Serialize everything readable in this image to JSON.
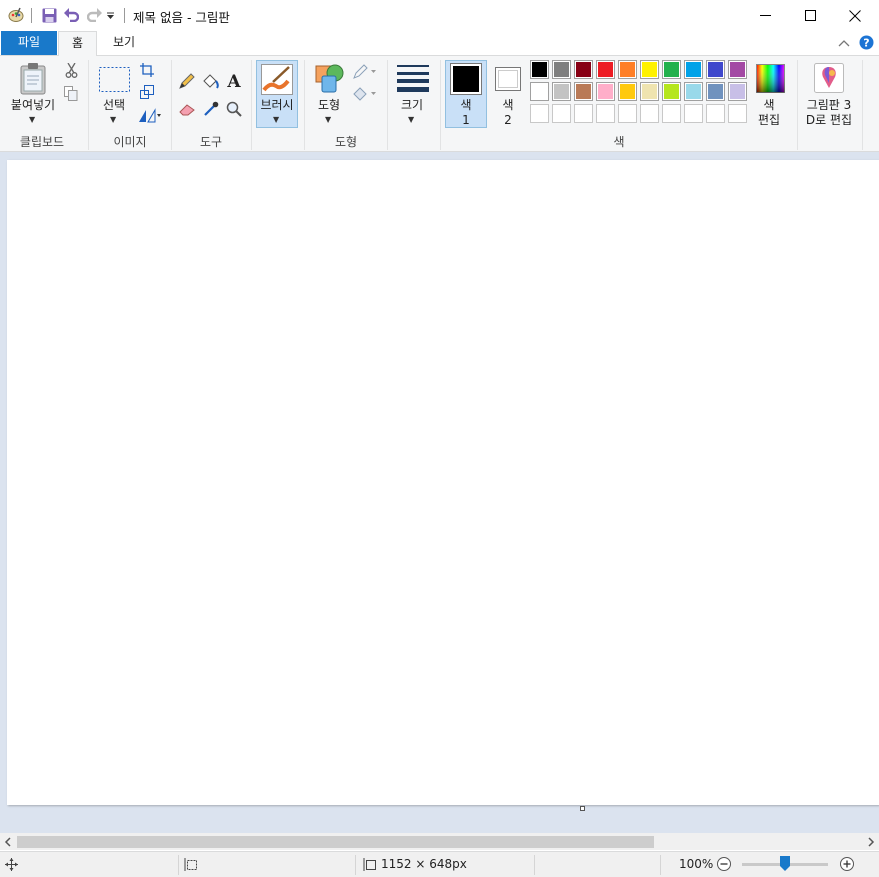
{
  "window": {
    "title": "제목 없음 - 그림판"
  },
  "tabs": {
    "file": "파일",
    "home": "홈",
    "view": "보기"
  },
  "groups": {
    "clipboard": "클립보드",
    "image": "이미지",
    "tools": "도구",
    "shapes": "도형",
    "colors": "색"
  },
  "buttons": {
    "paste": "붙여넣기",
    "select": "선택",
    "brushes": "브러시",
    "shapes": "도형",
    "size": "크기",
    "color1_a": "색",
    "color1_b": "1",
    "color2_a": "색",
    "color2_b": "2",
    "edit_colors_a": "색",
    "edit_colors_b": "편집",
    "paint3d_a": "그림판 3",
    "paint3d_b": "D로 편집"
  },
  "palette": {
    "row1": [
      "#000000",
      "#7f7f7f",
      "#880015",
      "#ed1c24",
      "#ff7f27",
      "#fff200",
      "#22b14c",
      "#00a2e8",
      "#3f48cc",
      "#a349a4"
    ],
    "row2": [
      "#ffffff",
      "#c3c3c3",
      "#b97a57",
      "#ffaec9",
      "#ffc90e",
      "#efe4b0",
      "#b5e61d",
      "#99d9ea",
      "#7092be",
      "#c8bfe7"
    ],
    "row3": [
      "#ffffff",
      "#ffffff",
      "#ffffff",
      "#ffffff",
      "#ffffff",
      "#ffffff",
      "#ffffff",
      "#ffffff",
      "#ffffff",
      "#ffffff"
    ],
    "color1": "#000000",
    "color2": "#ffffff",
    "accent": "#1979ca"
  },
  "status": {
    "dimensions": "1152 × 648px",
    "zoom": "100%",
    "zoom_level": 1.0
  }
}
